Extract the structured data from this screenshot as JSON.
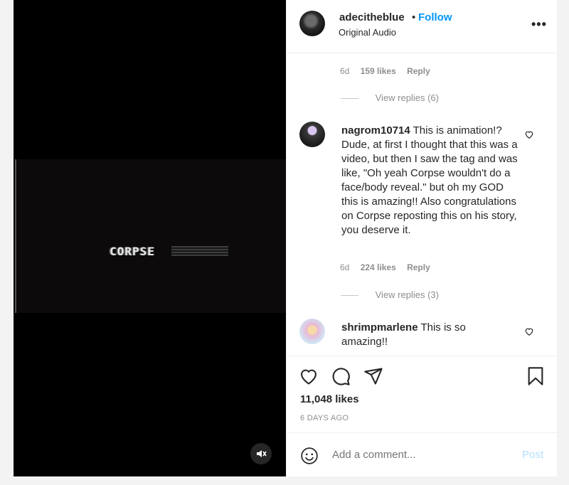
{
  "video": {
    "overlay_text": "CORPSE"
  },
  "header": {
    "username": "adecitheblue",
    "separator": "•",
    "follow_label": "Follow",
    "audio": "Original Audio",
    "more": "•••"
  },
  "comments": [
    {
      "meta_age": "6d",
      "meta_likes": "159 likes",
      "meta_reply": "Reply",
      "view_replies": "View replies (6)"
    },
    {
      "username": "nagrom10714",
      "text": "This is animation!? Dude, at first I thought that this was a video, but then I saw the tag and was like, \"Oh yeah Corpse wouldn't do a face/body reveal.\" but oh my GOD this is amazing!! Also congratulations on Corpse reposting this on his story, you deserve it.",
      "meta_age": "6d",
      "meta_likes": "224 likes",
      "meta_reply": "Reply",
      "view_replies": "View replies (3)"
    },
    {
      "username": "shrimpmarlene",
      "text": "This is so amazing!!"
    }
  ],
  "actions": {
    "likes": "11,048 likes",
    "ago": "6 DAYS AGO"
  },
  "comment_box": {
    "placeholder": "Add a comment...",
    "post_label": "Post"
  },
  "icons": {
    "like": "heart-icon",
    "comment": "comment-bubble-icon",
    "share": "paper-plane-icon",
    "save": "bookmark-icon",
    "emoji": "smiley-icon",
    "mute": "speaker-muted-icon"
  },
  "colors": {
    "link_blue": "#0095f6",
    "post_disabled": "#b2dffc",
    "meta_gray": "#8e8e8e"
  }
}
